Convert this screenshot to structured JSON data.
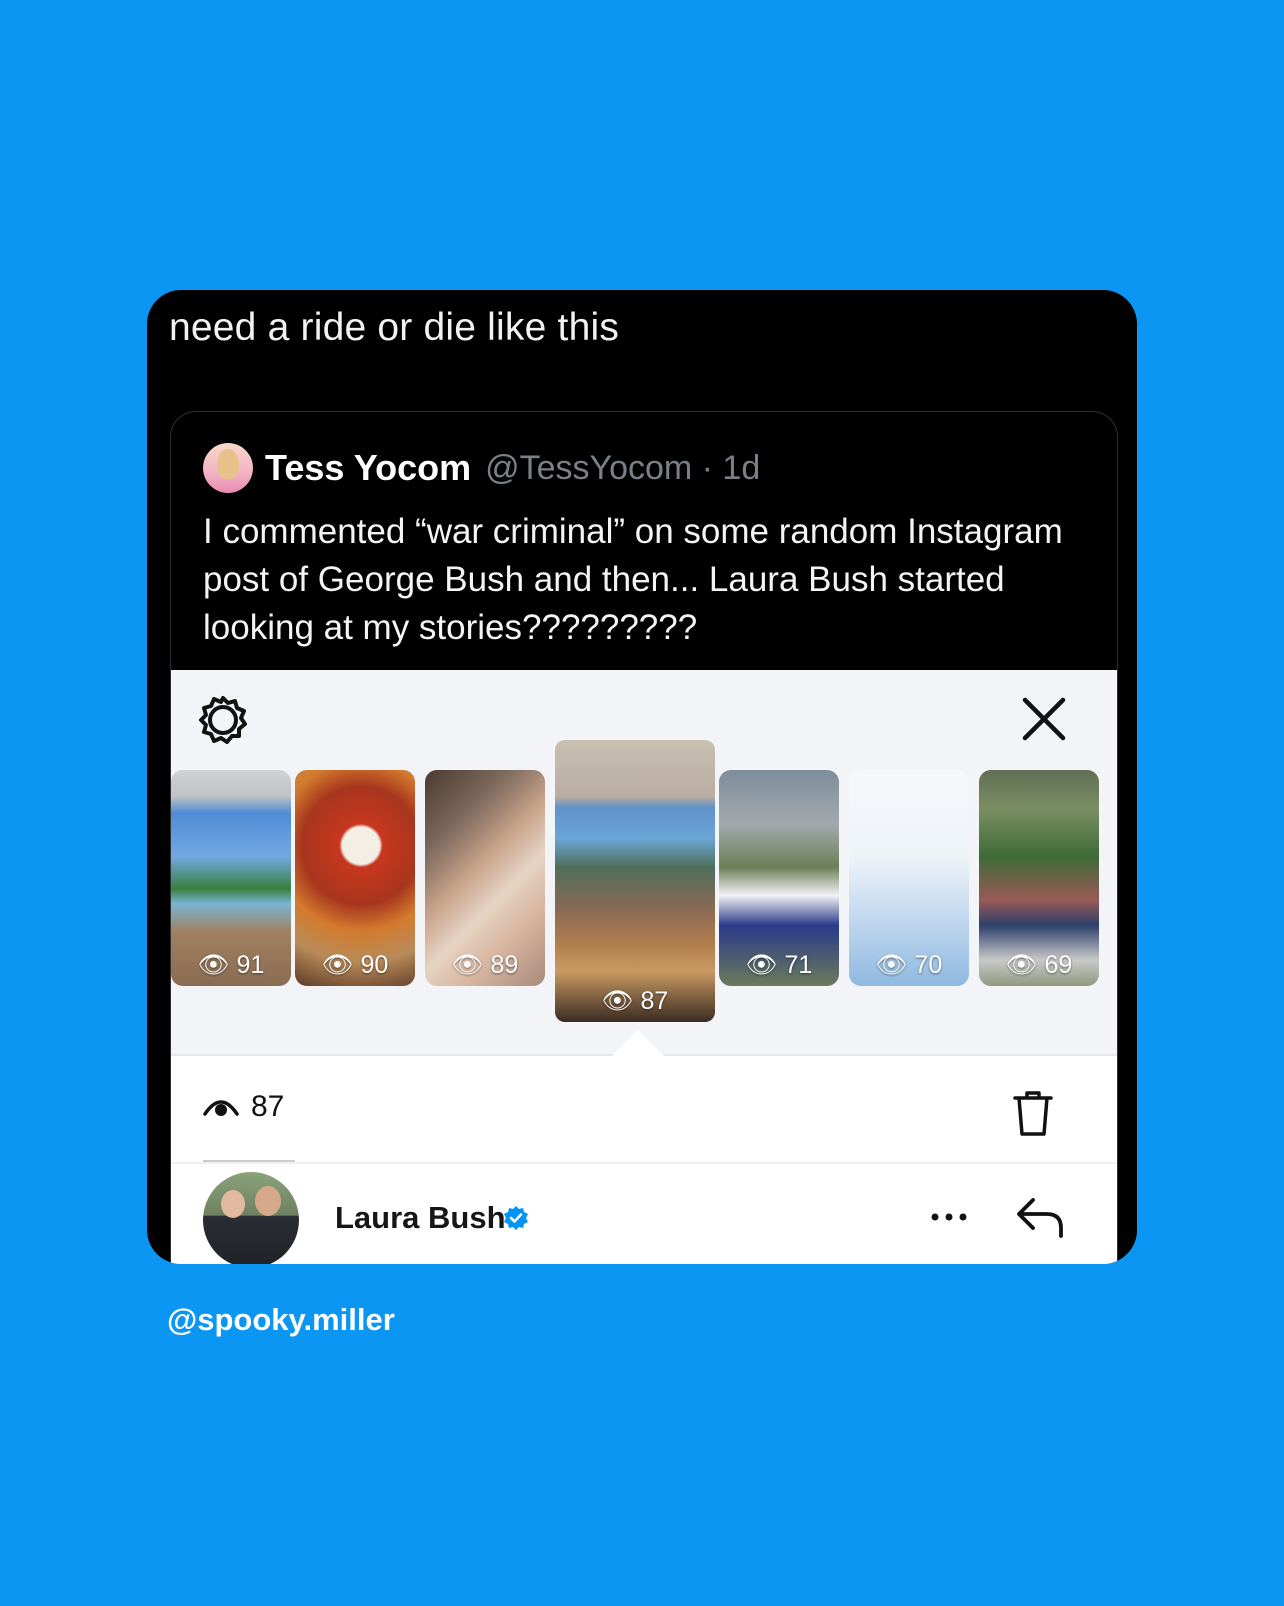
{
  "post": {
    "text": "need a ride or die like this"
  },
  "quoted_tweet": {
    "name": "Tess Yocom",
    "handle_time": "@TessYocom · 1d",
    "body": "I commented “war criminal” on some random Instagram post of George Bush and then... Laura Bush started looking at my stories?????????"
  },
  "instagram": {
    "stories": [
      {
        "views": "91"
      },
      {
        "views": "90"
      },
      {
        "views": "89"
      },
      {
        "views": "87"
      },
      {
        "views": "71"
      },
      {
        "views": "70"
      },
      {
        "views": "69"
      }
    ],
    "selected_views": "87",
    "viewer": {
      "name": "Laura Bush"
    }
  },
  "watermark": "@spooky.miller",
  "colors": {
    "background": "#0a96f2",
    "card": "#000000",
    "verified": "#0095f6"
  }
}
